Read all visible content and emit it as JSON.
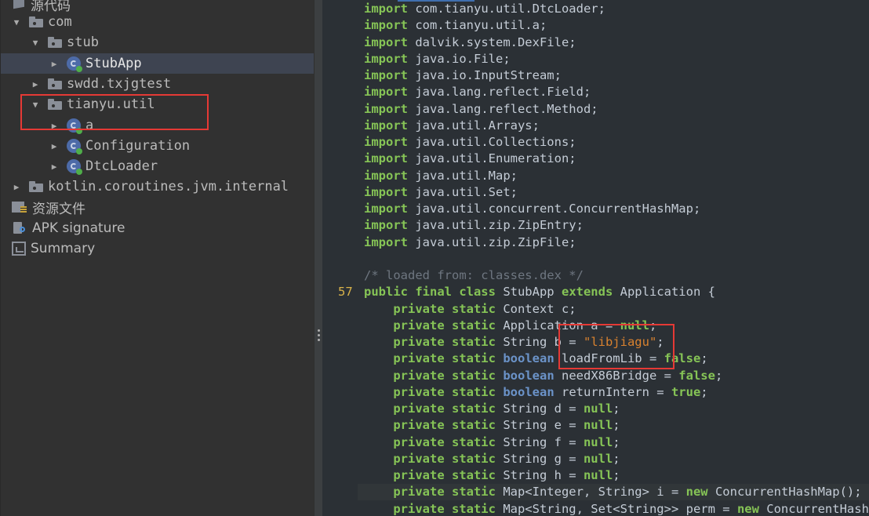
{
  "tree": {
    "items": [
      {
        "label": "源代码",
        "icon": "source-code-icon",
        "depth": 0,
        "arrow": "",
        "selected": false
      },
      {
        "label": "com",
        "icon": "package-folder-icon",
        "depth": 1,
        "arrow": "expanded",
        "selected": false
      },
      {
        "label": "stub",
        "icon": "package-folder-icon",
        "depth": 2,
        "arrow": "expanded",
        "selected": false
      },
      {
        "label": "StubApp",
        "icon": "class-icon",
        "depth": 3,
        "arrow": "collapsed",
        "selected": true
      },
      {
        "label": "swdd.txjgtest",
        "icon": "package-folder-icon",
        "depth": 2,
        "arrow": "collapsed",
        "selected": false
      },
      {
        "label": "tianyu.util",
        "icon": "package-folder-icon",
        "depth": 2,
        "arrow": "expanded",
        "selected": false
      },
      {
        "label": "a",
        "icon": "class-icon",
        "depth": 3,
        "arrow": "collapsed",
        "selected": false
      },
      {
        "label": "Configuration",
        "icon": "class-icon",
        "depth": 3,
        "arrow": "collapsed",
        "selected": false
      },
      {
        "label": "DtcLoader",
        "icon": "class-icon",
        "depth": 3,
        "arrow": "collapsed",
        "selected": false
      },
      {
        "label": "kotlin.coroutines.jvm.internal",
        "icon": "package-folder-icon",
        "depth": 1,
        "arrow": "collapsed",
        "selected": false
      },
      {
        "label": "资源文件",
        "icon": "resources-folder-icon",
        "depth": 0,
        "arrow": "",
        "selected": false
      },
      {
        "label": "APK signature",
        "icon": "apk-signature-icon",
        "depth": 0,
        "arrow": "",
        "selected": false
      },
      {
        "label": "Summary",
        "icon": "summary-icon",
        "depth": 0,
        "arrow": "",
        "selected": false
      }
    ]
  },
  "code": {
    "lines": [
      {
        "ln": "",
        "tokens": [
          [
            "kw",
            "import"
          ],
          [
            "t",
            " com.tianyu.util.DtcLoader;"
          ]
        ]
      },
      {
        "ln": "",
        "tokens": [
          [
            "kw",
            "import"
          ],
          [
            "t",
            " com.tianyu.util.a;"
          ]
        ]
      },
      {
        "ln": "",
        "tokens": [
          [
            "kw",
            "import"
          ],
          [
            "t",
            " dalvik.system.DexFile;"
          ]
        ]
      },
      {
        "ln": "",
        "tokens": [
          [
            "kw",
            "import"
          ],
          [
            "t",
            " java.io.File;"
          ]
        ]
      },
      {
        "ln": "",
        "tokens": [
          [
            "kw",
            "import"
          ],
          [
            "t",
            " java.io.InputStream;"
          ]
        ]
      },
      {
        "ln": "",
        "tokens": [
          [
            "kw",
            "import"
          ],
          [
            "t",
            " java.lang.reflect.Field;"
          ]
        ]
      },
      {
        "ln": "",
        "tokens": [
          [
            "kw",
            "import"
          ],
          [
            "t",
            " java.lang.reflect.Method;"
          ]
        ]
      },
      {
        "ln": "",
        "tokens": [
          [
            "kw",
            "import"
          ],
          [
            "t",
            " java.util.Arrays;"
          ]
        ]
      },
      {
        "ln": "",
        "tokens": [
          [
            "kw",
            "import"
          ],
          [
            "t",
            " java.util.Collections;"
          ]
        ]
      },
      {
        "ln": "",
        "tokens": [
          [
            "kw",
            "import"
          ],
          [
            "t",
            " java.util.Enumeration;"
          ]
        ]
      },
      {
        "ln": "",
        "tokens": [
          [
            "kw",
            "import"
          ],
          [
            "t",
            " java.util.Map;"
          ]
        ]
      },
      {
        "ln": "",
        "tokens": [
          [
            "kw",
            "import"
          ],
          [
            "t",
            " java.util.Set;"
          ]
        ]
      },
      {
        "ln": "",
        "tokens": [
          [
            "kw",
            "import"
          ],
          [
            "t",
            " java.util.concurrent.ConcurrentHashMap;"
          ]
        ]
      },
      {
        "ln": "",
        "tokens": [
          [
            "kw",
            "import"
          ],
          [
            "t",
            " java.util.zip.ZipEntry;"
          ]
        ]
      },
      {
        "ln": "",
        "tokens": [
          [
            "kw",
            "import"
          ],
          [
            "t",
            " java.util.zip.ZipFile;"
          ]
        ]
      },
      {
        "ln": "",
        "tokens": []
      },
      {
        "ln": "",
        "tokens": [
          [
            "cm",
            "/* loaded from: classes.dex */"
          ]
        ]
      },
      {
        "ln": "57",
        "tokens": [
          [
            "kw",
            "public final class"
          ],
          [
            "t",
            " StubApp "
          ],
          [
            "kw",
            "extends"
          ],
          [
            "t",
            " Application {"
          ]
        ]
      },
      {
        "ln": "",
        "tokens": [
          [
            "t",
            "    "
          ],
          [
            "kw",
            "private static"
          ],
          [
            "t",
            " Context c;"
          ]
        ]
      },
      {
        "ln": "",
        "tokens": [
          [
            "t",
            "    "
          ],
          [
            "kw",
            "private static"
          ],
          [
            "t",
            " Application a = "
          ],
          [
            "kw",
            "null"
          ],
          [
            "t",
            ";"
          ]
        ]
      },
      {
        "ln": "",
        "tokens": [
          [
            "t",
            "    "
          ],
          [
            "kw",
            "private static"
          ],
          [
            "t",
            " String b = "
          ],
          [
            "str",
            "\"libjiagu\""
          ],
          [
            "t",
            ";"
          ]
        ]
      },
      {
        "ln": "",
        "tokens": [
          [
            "t",
            "    "
          ],
          [
            "kw",
            "private static"
          ],
          [
            "t",
            " "
          ],
          [
            "prim",
            "boolean"
          ],
          [
            "t",
            " loadFromLib = "
          ],
          [
            "kw",
            "false"
          ],
          [
            "t",
            ";"
          ]
        ]
      },
      {
        "ln": "",
        "tokens": [
          [
            "t",
            "    "
          ],
          [
            "kw",
            "private static"
          ],
          [
            "t",
            " "
          ],
          [
            "prim",
            "boolean"
          ],
          [
            "t",
            " needX86Bridge = "
          ],
          [
            "kw",
            "false"
          ],
          [
            "t",
            ";"
          ]
        ]
      },
      {
        "ln": "",
        "tokens": [
          [
            "t",
            "    "
          ],
          [
            "kw",
            "private static"
          ],
          [
            "t",
            " "
          ],
          [
            "prim",
            "boolean"
          ],
          [
            "t",
            " returnIntern = "
          ],
          [
            "kw",
            "true"
          ],
          [
            "t",
            ";"
          ]
        ]
      },
      {
        "ln": "",
        "tokens": [
          [
            "t",
            "    "
          ],
          [
            "kw",
            "private static"
          ],
          [
            "t",
            " String d = "
          ],
          [
            "kw",
            "null"
          ],
          [
            "t",
            ";"
          ]
        ]
      },
      {
        "ln": "",
        "tokens": [
          [
            "t",
            "    "
          ],
          [
            "kw",
            "private static"
          ],
          [
            "t",
            " String e = "
          ],
          [
            "kw",
            "null"
          ],
          [
            "t",
            ";"
          ]
        ]
      },
      {
        "ln": "",
        "tokens": [
          [
            "t",
            "    "
          ],
          [
            "kw",
            "private static"
          ],
          [
            "t",
            " String f = "
          ],
          [
            "kw",
            "null"
          ],
          [
            "t",
            ";"
          ]
        ]
      },
      {
        "ln": "",
        "tokens": [
          [
            "t",
            "    "
          ],
          [
            "kw",
            "private static"
          ],
          [
            "t",
            " String g = "
          ],
          [
            "kw",
            "null"
          ],
          [
            "t",
            ";"
          ]
        ]
      },
      {
        "ln": "",
        "tokens": [
          [
            "t",
            "    "
          ],
          [
            "kw",
            "private static"
          ],
          [
            "t",
            " String h = "
          ],
          [
            "kw",
            "null"
          ],
          [
            "t",
            ";"
          ]
        ]
      },
      {
        "ln": "",
        "highlight": true,
        "tokens": [
          [
            "t",
            "    "
          ],
          [
            "kw",
            "private static"
          ],
          [
            "t",
            " Map<Integer, String> i = "
          ],
          [
            "kw",
            "new"
          ],
          [
            "t",
            " ConcurrentHashMap();"
          ]
        ]
      },
      {
        "ln": "",
        "tokens": [
          [
            "t",
            "    "
          ],
          [
            "kw",
            "private static"
          ],
          [
            "t",
            " Map<String, Set<String>> perm = "
          ],
          [
            "kw",
            "new"
          ],
          [
            "t",
            " ConcurrentHashMap();"
          ]
        ]
      }
    ]
  },
  "annotations": {
    "color": "#e53935",
    "boxes": [
      "tianyu.util package highlight",
      "libjiagu string highlight"
    ]
  }
}
